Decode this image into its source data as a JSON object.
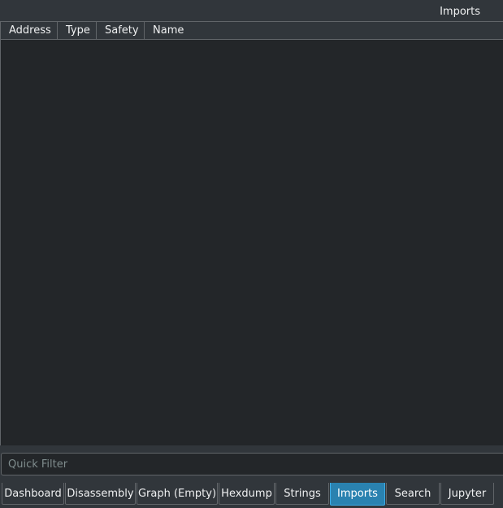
{
  "dock": {
    "title": "Imports"
  },
  "table": {
    "columns": [
      "Address",
      "Type",
      "Safety",
      "Name"
    ],
    "rows": []
  },
  "filter": {
    "placeholder": "Quick Filter",
    "value": ""
  },
  "tabs": [
    {
      "label": "Dashboard",
      "active": false
    },
    {
      "label": "Disassembly",
      "active": false
    },
    {
      "label": "Graph (Empty)",
      "active": false
    },
    {
      "label": "Hexdump",
      "active": false
    },
    {
      "label": "Strings",
      "active": false
    },
    {
      "label": "Imports",
      "active": true
    },
    {
      "label": "Search",
      "active": false
    },
    {
      "label": "Jupyter",
      "active": false
    }
  ],
  "colors": {
    "window_bg": "#31363b",
    "view_bg": "#232629",
    "border": "#616569",
    "active_tab": "#2a82b0",
    "text": "#eff0f1"
  }
}
